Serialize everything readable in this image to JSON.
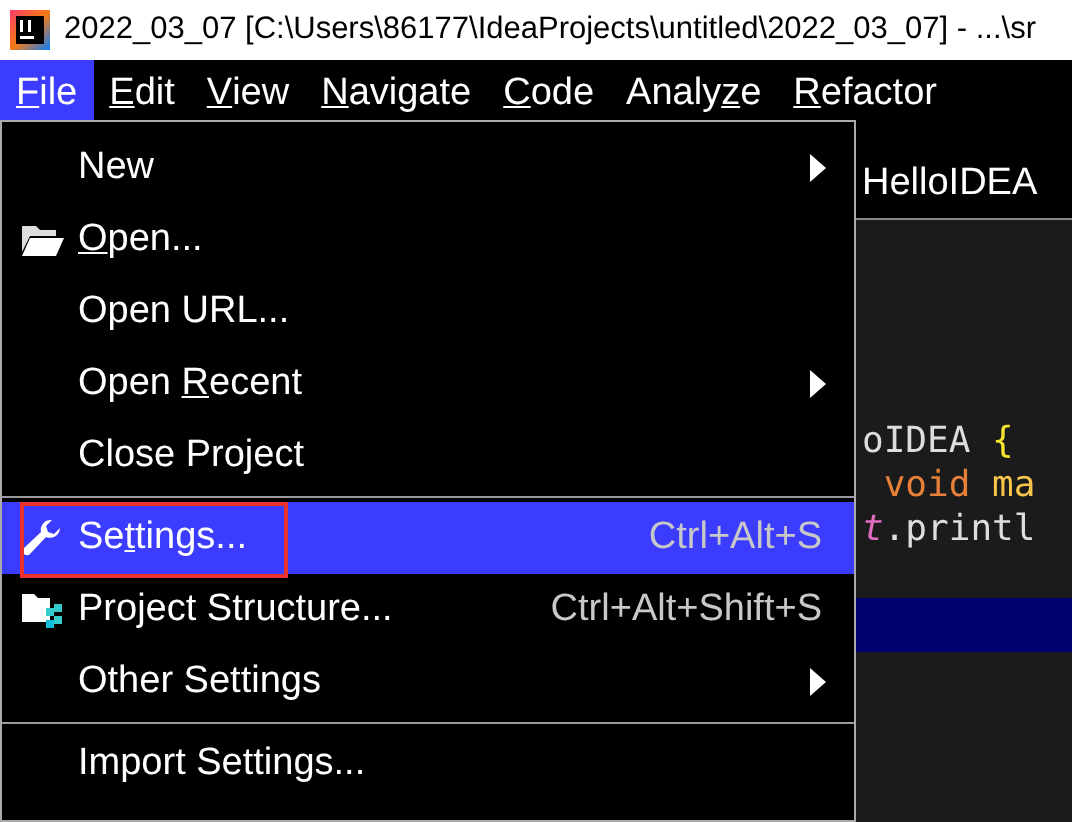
{
  "window": {
    "title": "2022_03_07 [C:\\Users\\86177\\IdeaProjects\\untitled\\2022_03_07] - ...\\sr"
  },
  "menubar": [
    {
      "label": "File",
      "selected": true
    },
    {
      "label": "Edit",
      "selected": false
    },
    {
      "label": "View",
      "selected": false
    },
    {
      "label": "Navigate",
      "selected": false
    },
    {
      "label": "Code",
      "selected": false
    },
    {
      "label": "Analyze",
      "selected": false
    },
    {
      "label": "Refactor",
      "selected": false
    }
  ],
  "file_menu": [
    {
      "kind": "item",
      "label": "New",
      "submenu": true,
      "selected": false
    },
    {
      "kind": "item",
      "label": "Open...",
      "selected": false
    },
    {
      "kind": "item",
      "label": "Open URL...",
      "selected": false
    },
    {
      "kind": "item",
      "label": "Open Recent",
      "submenu": true,
      "selected": false
    },
    {
      "kind": "item",
      "label": "Close Project",
      "selected": false
    },
    {
      "kind": "separator"
    },
    {
      "kind": "item",
      "label": "Settings...",
      "shortcut": "Ctrl+Alt+S",
      "selected": true
    },
    {
      "kind": "item",
      "label": "Project Structure...",
      "shortcut": "Ctrl+Alt+Shift+S",
      "selected": false
    },
    {
      "kind": "item",
      "label": "Other Settings",
      "submenu": true,
      "selected": false
    },
    {
      "kind": "separator"
    },
    {
      "kind": "item",
      "label": "Import Settings...",
      "selected": false
    }
  ],
  "editor": {
    "tab": "HelloIDEA",
    "lines": [
      [
        {
          "kind": "plain",
          "text": "oIDEA "
        },
        {
          "kind": "brace",
          "text": "{"
        }
      ],
      [
        {
          "kind": "keyword",
          "text": " void "
        },
        {
          "kind": "method",
          "text": "ma"
        }
      ],
      [
        {
          "kind": "field",
          "text": "t"
        },
        {
          "kind": "plain",
          "text": ".printl"
        }
      ]
    ]
  }
}
